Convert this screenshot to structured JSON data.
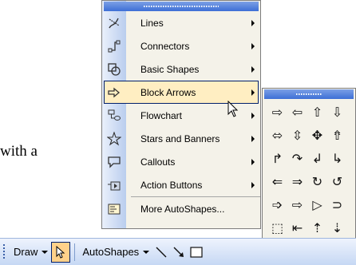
{
  "document": {
    "fragment": "with a"
  },
  "autoshapes_menu": {
    "items": [
      {
        "label": "Lines",
        "icon": "lines-icon",
        "submenu": true
      },
      {
        "label": "Connectors",
        "icon": "connectors-icon",
        "submenu": true
      },
      {
        "label": "Basic Shapes",
        "icon": "basic-shapes-icon",
        "submenu": true
      },
      {
        "label": "Block Arrows",
        "icon": "block-arrows-icon",
        "submenu": true,
        "selected": true
      },
      {
        "label": "Flowchart",
        "icon": "flowchart-icon",
        "submenu": true
      },
      {
        "label": "Stars and Banners",
        "icon": "stars-banners-icon",
        "submenu": true
      },
      {
        "label": "Callouts",
        "icon": "callouts-icon",
        "submenu": true
      },
      {
        "label": "Action Buttons",
        "icon": "action-buttons-icon",
        "submenu": true
      },
      {
        "label": "More AutoShapes...",
        "icon": "more-autoshapes-icon",
        "submenu": false
      }
    ]
  },
  "block_arrows_submenu": {
    "shapes": [
      [
        "⇨",
        "⇦",
        "⇧",
        "⇩"
      ],
      [
        "⬄",
        "⇳",
        "✥",
        "⇮"
      ],
      [
        "↱",
        "↷",
        "↲",
        "↳"
      ],
      [
        "⇐",
        "⇒",
        "↻",
        "↺"
      ],
      [
        "➩",
        "⇨",
        "▷",
        "⊃"
      ],
      [
        "⬚",
        "⇤",
        "⇡",
        "⇣"
      ],
      [
        "✚",
        "✣",
        "✤",
        "↶"
      ]
    ]
  },
  "drawing_toolbar": {
    "draw_label": "Draw",
    "autoshapes_label": "AutoShapes",
    "tools": [
      "select-pointer-icon",
      "line-tool-icon",
      "arrow-tool-icon",
      "rectangle-tool-icon"
    ]
  },
  "colors": {
    "highlight": "#ffeec2",
    "toolbar_selected": "#ffd18a",
    "menu_bg": "#f4f2e9"
  }
}
